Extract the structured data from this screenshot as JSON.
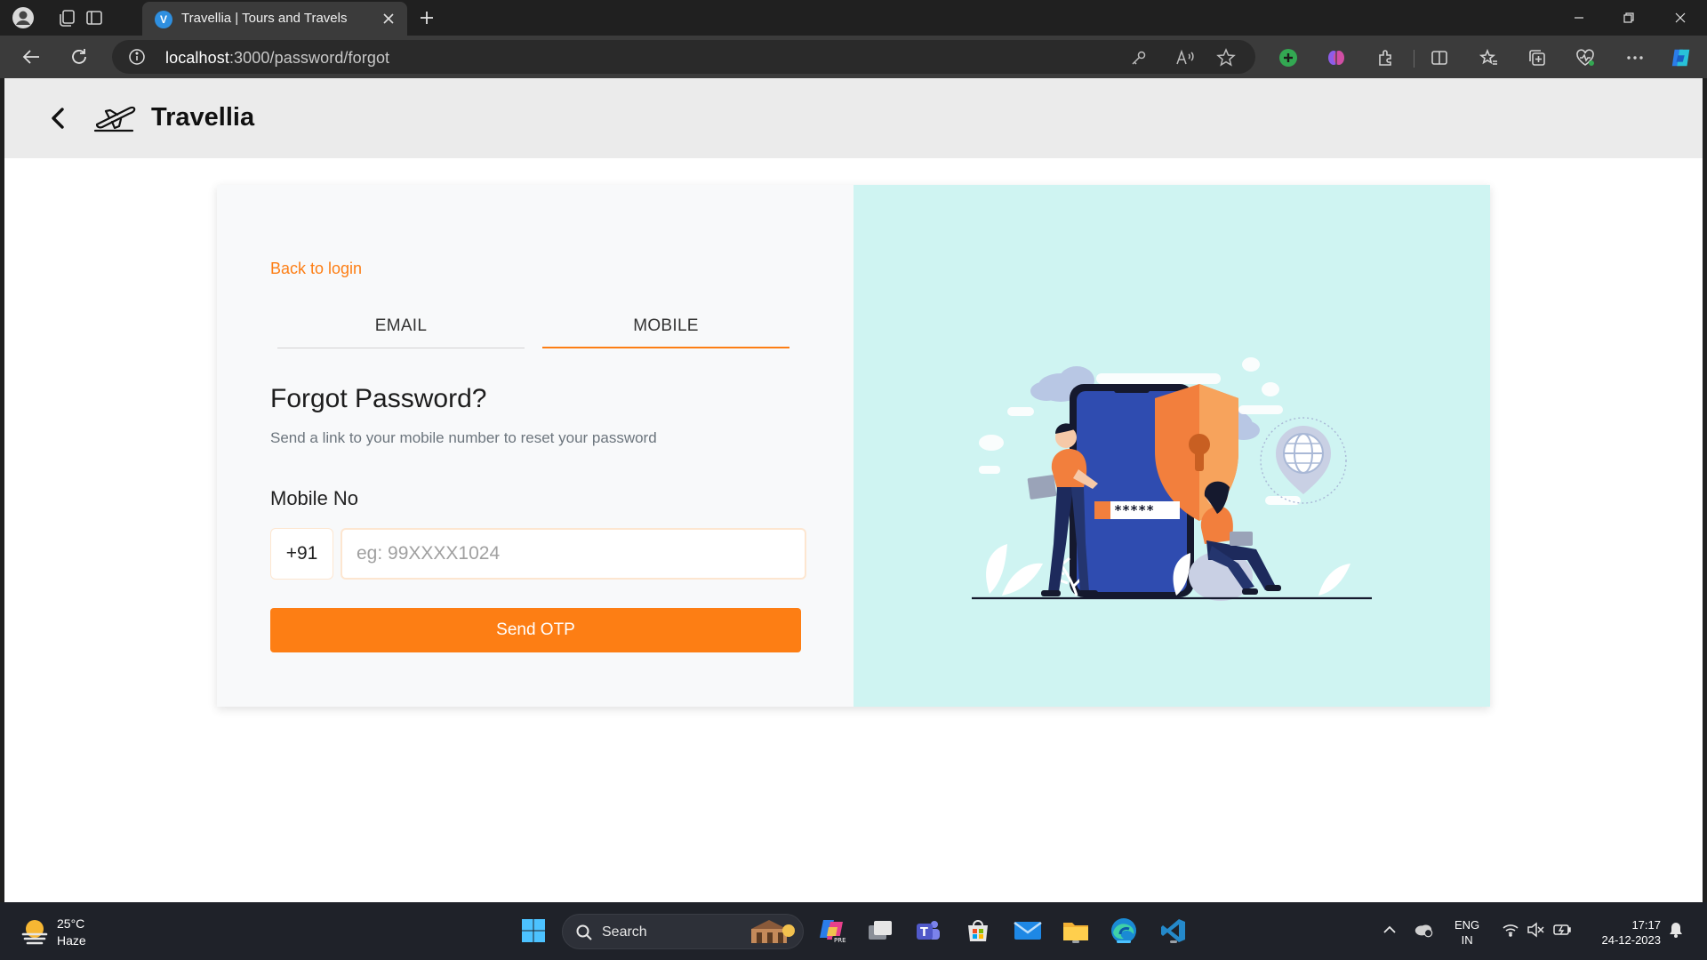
{
  "browser": {
    "tab_title": "Travellia | Tours and Travels",
    "tab_favicon_letter": "V",
    "url_host": "localhost",
    "url_path": ":3000/password/forgot"
  },
  "app": {
    "brand": "Travellia"
  },
  "forgot_form": {
    "back_link": "Back to login",
    "tabs": [
      {
        "label": "EMAIL",
        "active": false
      },
      {
        "label": "MOBILE",
        "active": true
      }
    ],
    "heading": "Forgot Password?",
    "subtext": "Send a link to your mobile number to reset your password",
    "mobile_label": "Mobile No",
    "country_code": "+91",
    "mobile_placeholder": "eg: 99XXXX1024",
    "mobile_value": "",
    "submit_label": "Send OTP"
  },
  "illustration": {
    "password_mask": "*****"
  },
  "taskbar": {
    "weather_temp": "25°C",
    "weather_condition": "Haze",
    "search_label": "Search",
    "lang_line1": "ENG",
    "lang_line2": "IN",
    "time": "17:17",
    "date": "24-12-2023"
  },
  "colors": {
    "accent": "#fd7e14",
    "illustration_bg": "#cff4f2",
    "card_left_bg": "#f8f9fa",
    "header_bg": "#ebebeb"
  }
}
